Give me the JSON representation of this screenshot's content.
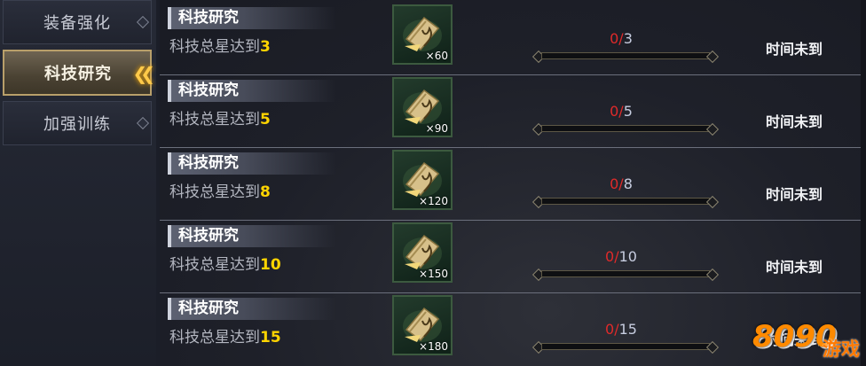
{
  "sidebar": {
    "items": [
      {
        "label": "装备强化",
        "active": false
      },
      {
        "label": "科技研究",
        "active": true
      },
      {
        "label": "加强训练",
        "active": false
      }
    ]
  },
  "tasks": [
    {
      "title": "科技研究",
      "desc_prefix": "科技总星达到",
      "desc_value": "3",
      "reward_qty": "×60",
      "current": "0",
      "separator": "/",
      "total": "3",
      "status": "时间未到"
    },
    {
      "title": "科技研究",
      "desc_prefix": "科技总星达到",
      "desc_value": "5",
      "reward_qty": "×90",
      "current": "0",
      "separator": "/",
      "total": "5",
      "status": "时间未到"
    },
    {
      "title": "科技研究",
      "desc_prefix": "科技总星达到",
      "desc_value": "8",
      "reward_qty": "×120",
      "current": "0",
      "separator": "/",
      "total": "8",
      "status": "时间未到"
    },
    {
      "title": "科技研究",
      "desc_prefix": "科技总星达到",
      "desc_value": "10",
      "reward_qty": "×150",
      "current": "0",
      "separator": "/",
      "total": "10",
      "status": "时间未到"
    },
    {
      "title": "科技研究",
      "desc_prefix": "科技总星达到",
      "desc_value": "15",
      "reward_qty": "×180",
      "current": "0",
      "separator": "/",
      "total": "15",
      "status": "时间未到"
    }
  ],
  "watermark": {
    "logo": "8090",
    "text": "游戏"
  },
  "colors": {
    "accent_gold": "#ffd400",
    "progress_current": "#e02a2a",
    "active_tab": "#b89f6a"
  },
  "icons": {
    "reward": "scroll-icon",
    "active_indicator": "chevron-left-icon"
  }
}
